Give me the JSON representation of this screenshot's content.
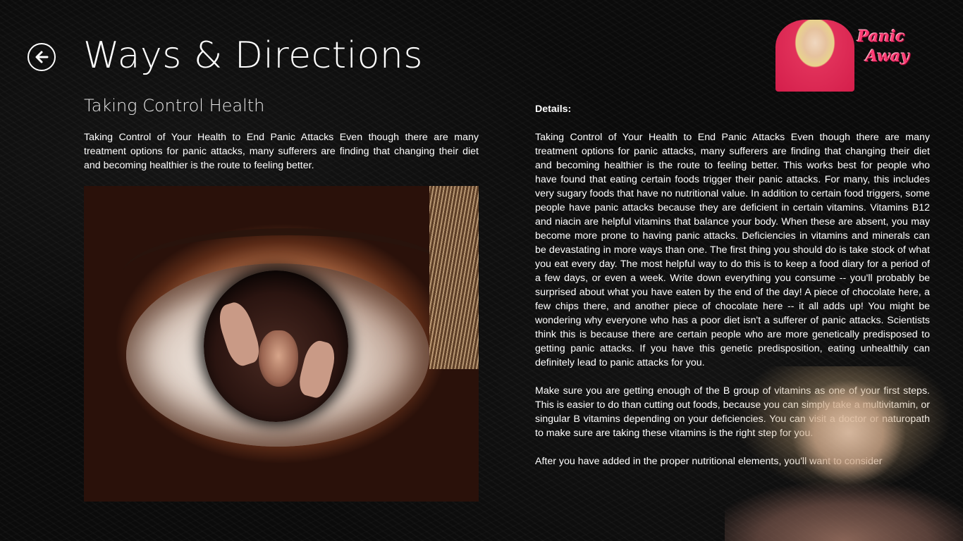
{
  "header": {
    "title": "Ways & Directions",
    "back_icon": "arrow-left-circle-icon"
  },
  "logo": {
    "line1": "Panic",
    "line2": "Away",
    "color": "#ff3c74"
  },
  "article": {
    "subtitle": "Taking Control Health",
    "summary": "Taking Control of Your Health to End Panic Attacks Even though there are many treatment options for panic attacks, many sufferers are finding that changing their diet and becoming healthier is the route to feeling better."
  },
  "details": {
    "label": "Details:",
    "paragraphs": [
      "Taking Control of Your Health to End Panic Attacks Even though there are many treatment options for panic attacks, many sufferers are finding that changing their diet and becoming healthier is the route to feeling better. This works best for people who have found that eating certain foods trigger their panic attacks. For many, this includes very sugary foods that have no nutritional value. In addition to certain food triggers, some people have panic attacks because they are deficient in certain vitamins. Vitamins B12 and niacin are helpful vitamins that balance your body. When these are absent, you may become more prone to having panic attacks. Deficiencies in vitamins and minerals can be devastating in more ways than one. The first thing you should do is take stock of what you eat every day. The most helpful way to do this is to keep a food diary for a period of a few days, or even a week. Write down everything you consume -- you'll probably be surprised about what you have eaten by the end of the day! A piece of chocolate here, a few chips there, and another piece of chocolate here -- it all adds up! You might be wondering why everyone who has a poor diet isn't a sufferer of panic attacks. Scientists think this is because there are certain people who are more genetically predisposed to getting panic attacks. If you have this genetic predisposition, eating unhealthily can definitely lead to panic attacks for you.",
      "Make sure you are getting enough of the B group of vitamins as one of your first steps. This is easier to do than cutting out foods, because you can simply take a multivitamin, or singular B vitamins depending on your deficiencies. You can visit a doctor or naturopath to make sure are taking these vitamins is the right step for you.",
      "After you have added in the proper nutritional elements, you'll want to consider"
    ]
  }
}
